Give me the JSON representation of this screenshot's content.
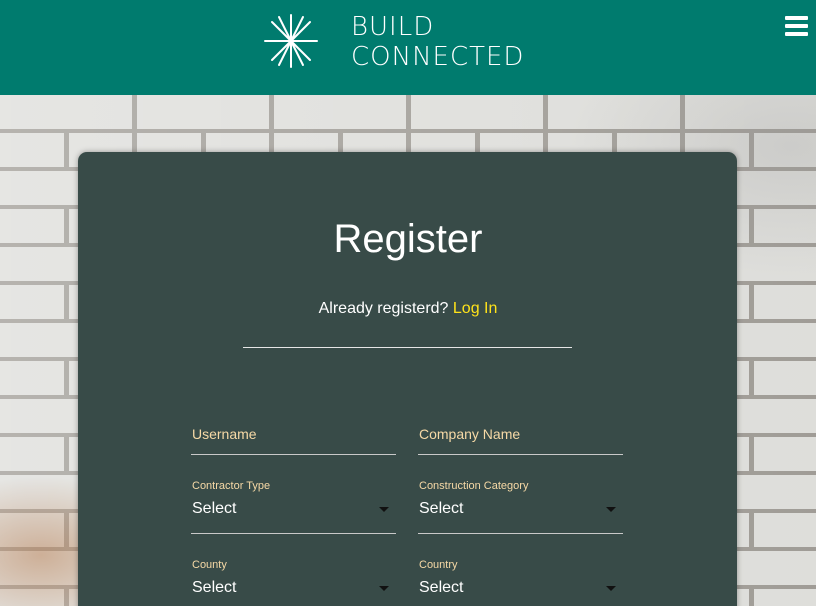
{
  "header": {
    "logo_line1": "BUILD",
    "logo_line2": "CONNECTED",
    "brand_color": "#007b6e",
    "menu_icon": "hamburger-menu-icon",
    "logo_icon": "starburst-logo-icon"
  },
  "register": {
    "title": "Register",
    "already_text": "Already registerd?",
    "login_link": "Log In",
    "link_color": "#ffe31a",
    "card_color": "#384b48"
  },
  "form": {
    "username_placeholder": "Username",
    "company_placeholder": "Company Name",
    "contractor_type": {
      "label": "Contractor Type",
      "value": "Select"
    },
    "construction_category": {
      "label": "Construction Category",
      "value": "Select"
    },
    "county": {
      "label": "County",
      "value": "Select"
    },
    "country": {
      "label": "Country",
      "value": "Select"
    },
    "label_color": "#f6d9a6"
  }
}
